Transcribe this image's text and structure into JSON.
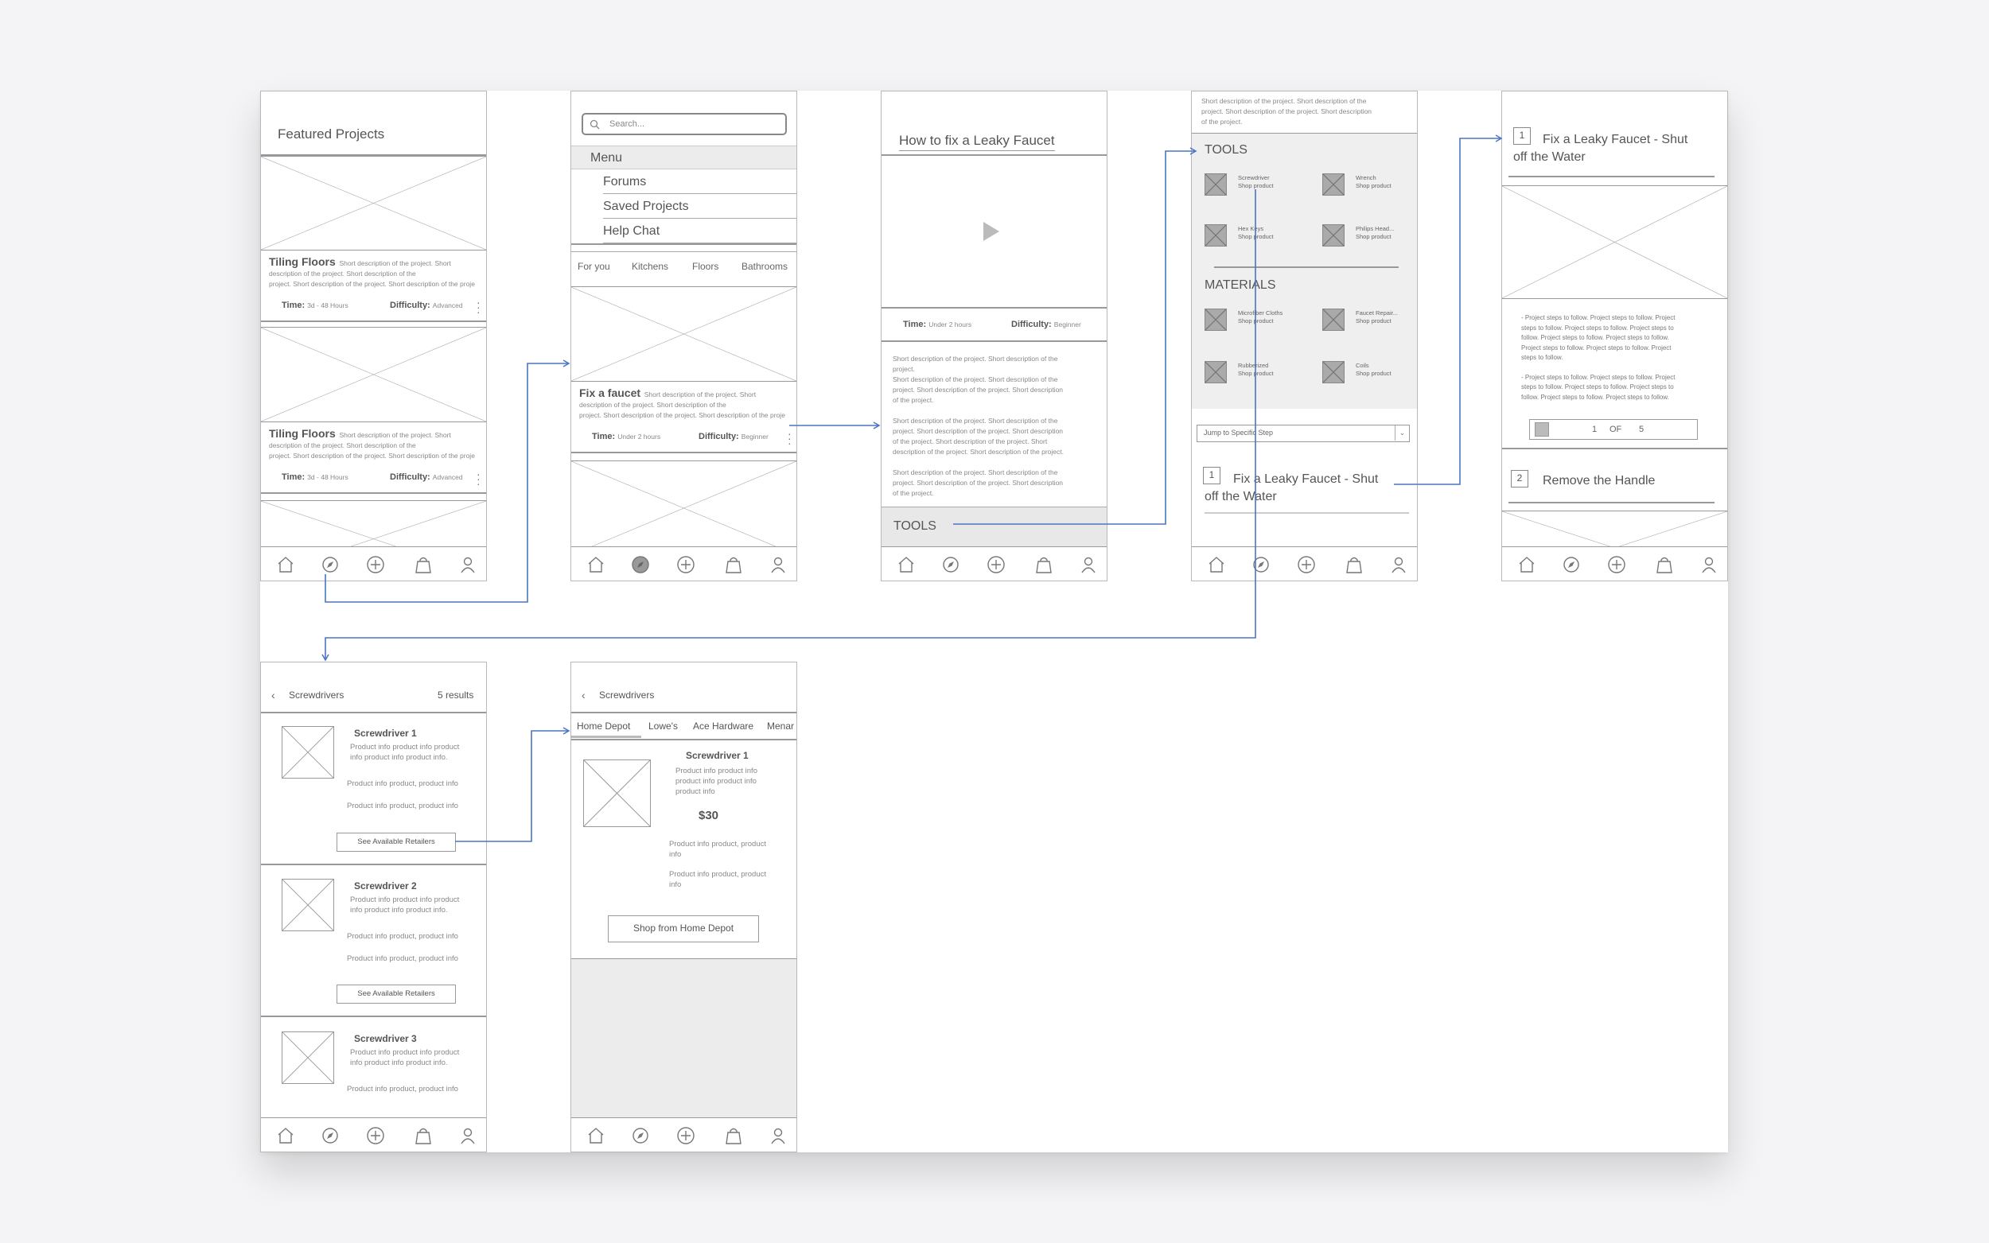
{
  "accent_color": "#4a74c4",
  "nav_icons": [
    "home-icon",
    "compass-icon",
    "plus-circle-icon",
    "shopping-bag-icon",
    "user-icon"
  ],
  "screen1": {
    "header": "Featured Projects",
    "cards": [
      {
        "title": "Tiling Floors",
        "desc1": "Short description of the project. Short",
        "desc2": "description of the project. Short description of the",
        "desc3": "project. Short description of the project. Short description of the proje",
        "time_label": "Time:",
        "time_value": "3d - 48 Hours",
        "difficulty_label": "Difficulty:",
        "difficulty_value": "Advanced"
      },
      {
        "title": "Tiling Floors",
        "desc1": "Short description of the project. Short",
        "desc2": "description of the project. Short description of the",
        "desc3": "project. Short description of the project. Short description of the proje",
        "time_label": "Time:",
        "time_value": "3d - 48 Hours",
        "difficulty_label": "Difficulty:",
        "difficulty_value": "Advanced"
      }
    ]
  },
  "screen2": {
    "search_placeholder": "Search...",
    "menu_label": "Menu",
    "menu_items": [
      "Forums",
      "Saved Projects",
      "Help Chat"
    ],
    "tabs": [
      "For you",
      "Kitchens",
      "Floors",
      "Bathrooms"
    ],
    "card": {
      "title": "Fix a faucet",
      "desc1": "Short description of the project. Short",
      "desc2": "description of the project. Short description of the",
      "desc3": "project. Short description of the project. Short description of the proje",
      "time_label": "Time:",
      "time_value": "Under 2 hours",
      "difficulty_label": "Difficulty:",
      "difficulty_value": "Beginner"
    }
  },
  "screen3": {
    "title": "How to fix a Leaky Faucet",
    "time_label": "Time:",
    "time_value": "Under 2 hours",
    "difficulty_label": "Difficulty:",
    "difficulty_value": "Beginner",
    "paragraphs": [
      [
        "Short description of the project. Short description of the",
        "project.",
        "Short description of the project. Short description of the",
        "project. Short description of the project. Short description",
        "of the project."
      ],
      [
        "Short description of the project. Short description of the",
        "project. Short description of the project. Short description",
        "of the project. Short description of the project. Short",
        "description of the project. Short description of the project."
      ],
      [
        "Short description of the project. Short description of the",
        "project. Short description of the project. Short description",
        "of the project."
      ]
    ],
    "tools_label": "TOOLS"
  },
  "screen4": {
    "intro": [
      "Short description of the project. Short description of the",
      "project. Short description of the project. Short description",
      "of the project."
    ],
    "tools_header": "TOOLS",
    "tools": [
      {
        "name": "Screwdriver",
        "link": "Shop product"
      },
      {
        "name": "Wrench",
        "link": "Shop product"
      },
      {
        "name": "Hex Keys",
        "link": "Shop product"
      },
      {
        "name": "Philips Head...",
        "link": "Shop product"
      }
    ],
    "materials_header": "MATERIALS",
    "materials": [
      {
        "name": "Microfiber Cloths",
        "link": "Shop product"
      },
      {
        "name": "Faucet Repair...",
        "link": "Shop product"
      },
      {
        "name": "Rubberized",
        "link": "Shop product"
      },
      {
        "name": "Coils",
        "link": "Shop product"
      }
    ],
    "jump_label": "Jump to Specific Step",
    "step_number": "1",
    "step_title_1": "Fix a Leaky Faucet - Shut",
    "step_title_2": "off the Water"
  },
  "screen5": {
    "step_number": "1",
    "step_title_1": "Fix a Leaky Faucet - Shut",
    "step_title_2": "off the Water",
    "steps_text_1": [
      "- Project steps to follow. Project steps to follow. Project",
      "steps to follow. Project steps to follow. Project steps to",
      "follow. Project steps to follow. Project steps to follow.",
      "Project steps to follow. Project steps to follow. Project",
      "steps to follow."
    ],
    "steps_text_2": [
      "- Project steps to follow. Project steps to follow. Project",
      "steps to follow. Project steps to follow. Project steps to",
      "follow. Project steps to follow. Project steps to follow."
    ],
    "pager_current": "1",
    "pager_of": "OF",
    "pager_total": "5",
    "next_step_number": "2",
    "next_step_title": "Remove the Handle"
  },
  "screen6": {
    "back_title": "Screwdrivers",
    "results": "5 results",
    "products": [
      {
        "name": "Screwdriver 1",
        "info1": "Product info product info product",
        "info2": "info product info product info.",
        "line1": "Product info product, product info",
        "line2": "Product info product, product info",
        "button": "See Available Retailers"
      },
      {
        "name": "Screwdriver 2",
        "info1": "Product info product info product",
        "info2": "info product info product info.",
        "line1": "Product info product, product info",
        "line2": "Product info product, product info",
        "button": "See Available Retailers"
      },
      {
        "name": "Screwdriver 3",
        "info1": "Product info product info product",
        "info2": "info product info product info.",
        "line1": "Product info product, product info"
      }
    ]
  },
  "screen7": {
    "back_title": "Screwdrivers",
    "retailers": [
      "Home Depot",
      "Lowe's",
      "Ace Hardware",
      "Menar"
    ],
    "product_name": "Screwdriver 1",
    "info": [
      "Product info product info",
      "product info product info",
      "product info"
    ],
    "price": "$30",
    "line1a": "Product info product, product",
    "line1b": "info",
    "line2a": "Product info product, product",
    "line2b": "info",
    "button": "Shop from Home Depot"
  }
}
